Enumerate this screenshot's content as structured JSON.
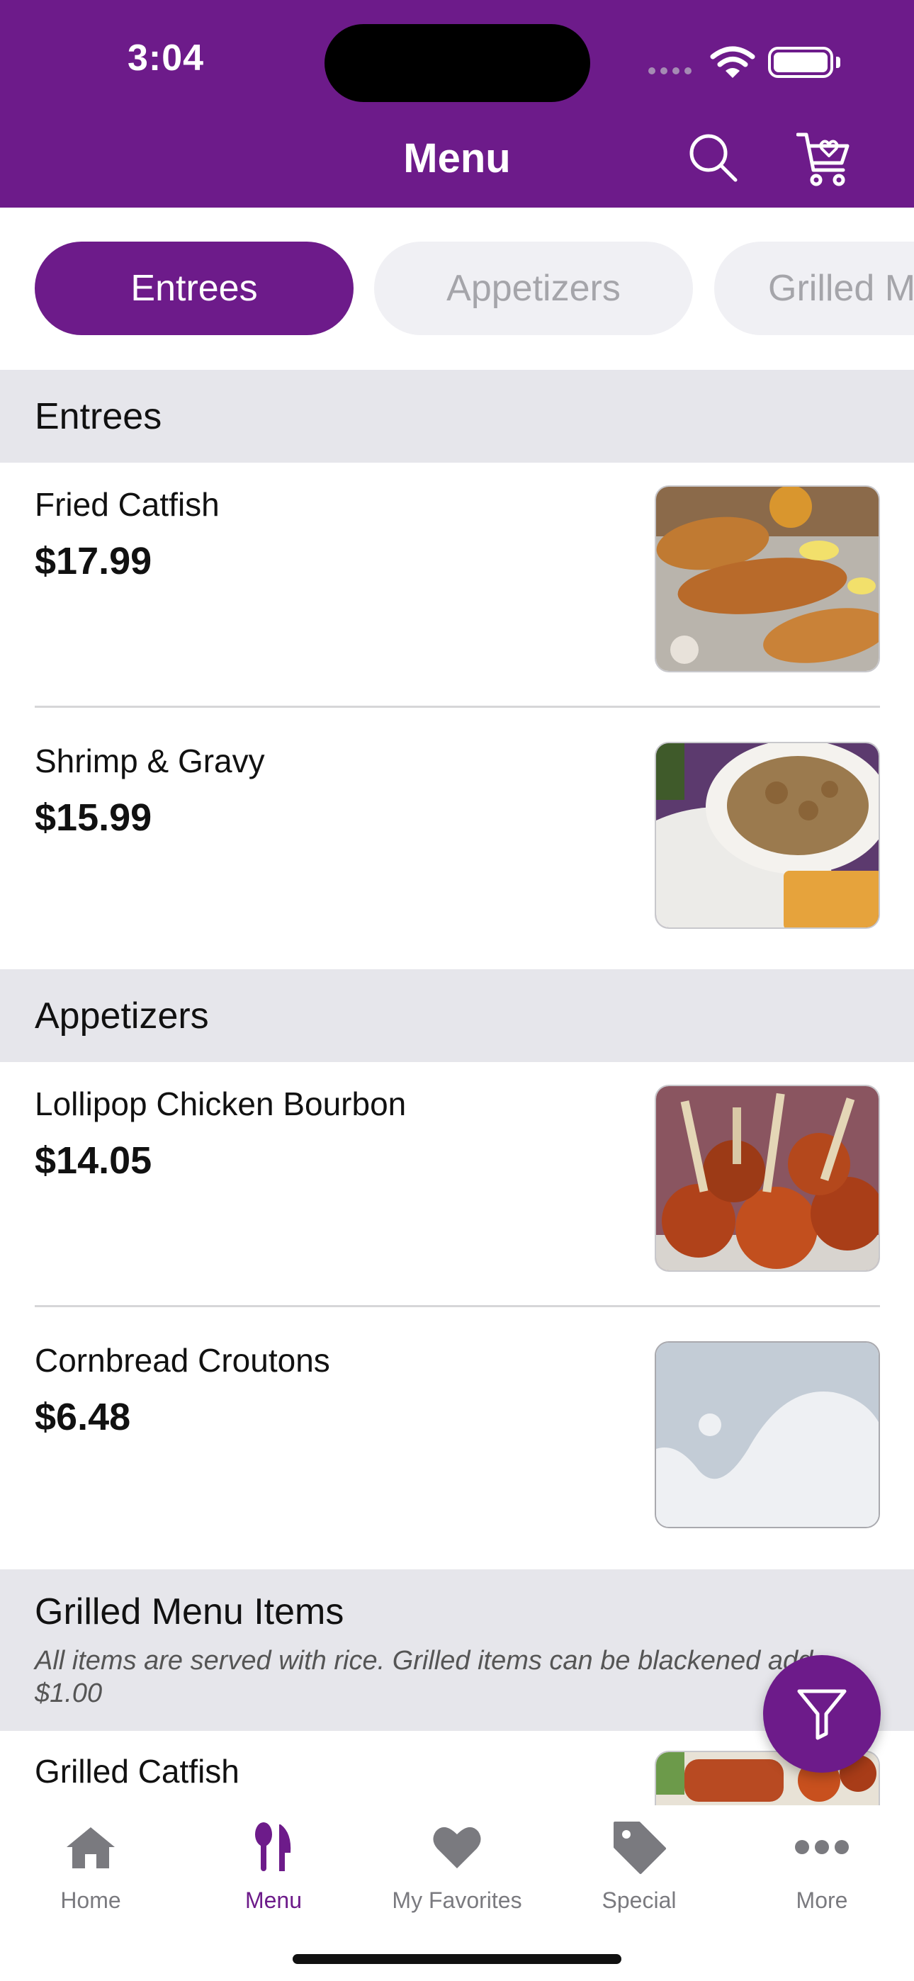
{
  "status_bar": {
    "time": "3:04"
  },
  "header": {
    "title": "Menu"
  },
  "category_tabs": [
    {
      "label": "Entrees",
      "active": true
    },
    {
      "label": "Appetizers",
      "active": false
    },
    {
      "label": "Grilled Menu Items",
      "active": false
    }
  ],
  "sections": [
    {
      "title": "Entrees",
      "items": [
        {
          "name": "Fried Catfish",
          "price": "$17.99",
          "image": "fried-catfish-photo"
        },
        {
          "name": "Shrimp & Gravy",
          "price": "$15.99",
          "image": "shrimp-gravy-photo"
        }
      ]
    },
    {
      "title": "Appetizers",
      "items": [
        {
          "name": "Lollipop Chicken Bourbon",
          "price": "$14.05",
          "image": "lollipop-chicken-photo"
        },
        {
          "name": "Cornbread Croutons",
          "price": "$6.48",
          "image": "placeholder-image"
        }
      ]
    },
    {
      "title": "Grilled Menu Items",
      "note": "All items are served with rice. Grilled items can be blackened add $1.00",
      "items": [
        {
          "name": "Grilled Catfish",
          "image": "grilled-catfish-photo"
        }
      ]
    }
  ],
  "tabbar": [
    {
      "label": "Home",
      "icon": "home-icon",
      "active": false
    },
    {
      "label": "Menu",
      "icon": "utensils-icon",
      "active": true
    },
    {
      "label": "My Favorites",
      "icon": "heart-icon",
      "active": false
    },
    {
      "label": "Special",
      "icon": "tag-icon",
      "active": false
    },
    {
      "label": "More",
      "icon": "more-icon",
      "active": false
    }
  ],
  "colors": {
    "brand": "#6d1b8a",
    "section_bg": "#e6e6eb",
    "inactive_tab_bg": "#f0f0f4"
  }
}
